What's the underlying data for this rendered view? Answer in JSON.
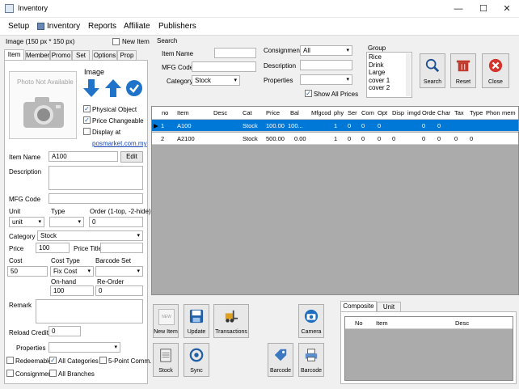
{
  "window": {
    "title": "Inventory",
    "minimize": "—",
    "maximize": "☐",
    "close": "✕"
  },
  "menu": [
    "Setup",
    "Inventory",
    "Reports",
    "Affiliate",
    "Publishers"
  ],
  "left": {
    "image_label": "Image (150 px * 150 px)",
    "new_item_label": "New Item",
    "tabs": [
      "Item",
      "Member",
      "Promo",
      "Set",
      "Options",
      "Prop"
    ],
    "photo_text": "Photo Not Available",
    "image_heading": "Image",
    "physical_object": "Physical Object",
    "price_changeable": "Price Changeable",
    "display_at": "Display at",
    "display_link": "posmarket.com.my",
    "item_name_label": "Item Name",
    "item_name_value": "A100",
    "edit_button": "Edit",
    "description_label": "Description",
    "mfg_code_label": "MFG Code",
    "unit_label": "Unit",
    "type_label": "Type",
    "order_label": "Order (1-top, -2-hide)",
    "unit_value": "unit",
    "order_value": "0",
    "category_label": "Category",
    "category_value": "Stock",
    "price_label": "Price",
    "price_value": "100",
    "price_title_label": "Price Title",
    "cost_label": "Cost",
    "cost_type_label": "Cost Type",
    "barcode_set_label": "Barcode Set",
    "cost_value": "50",
    "cost_type_value": "Fix Cost",
    "on_hand_label": "On-hand",
    "on_hand_value": "100",
    "reorder_label": "Re-Order",
    "reorder_value": "0",
    "remark_label": "Remark",
    "reload_credit_label": "Reload Credit",
    "reload_credit_value": "0",
    "properties_label": "Properties",
    "redeemable": "Redeemable",
    "all_categories": "All Categories",
    "five_point": "5-Point Comm.",
    "consignment": "Consignment",
    "all_branches": "All Branches"
  },
  "search": {
    "heading": "Search",
    "item_name": "Item Name",
    "mfg_code": "MFG Code",
    "category": "Category",
    "category_value": "Stock",
    "consignment": "Consignment",
    "consignment_value": "All",
    "description": "Description",
    "properties": "Properties",
    "show_all_prices": "Show All Prices",
    "group_label": "Group",
    "groups": [
      "Rice",
      "Drink",
      "Large",
      "cover 1",
      "cover 2"
    ],
    "search_btn": "Search",
    "reset_btn": "Reset",
    "close_btn": "Close"
  },
  "grid": {
    "headers": [
      "no",
      "Item",
      "Desc",
      "Cat",
      "Price",
      "Bal",
      "Mfgcod",
      "phy",
      "Ser",
      "Com",
      "Opt",
      "Disp",
      "imgd",
      "Orde",
      "Char",
      "Tax",
      "Type",
      "Phon",
      "mem"
    ],
    "rows": [
      [
        "1",
        "A100",
        "",
        "Stock",
        "100.00",
        "100...",
        "",
        "1",
        "0",
        "0",
        "0",
        "",
        "",
        "0",
        "0",
        "",
        "",
        "",
        ""
      ],
      [
        "2",
        "A2100",
        "",
        "Stock",
        "500.00",
        "0.00",
        "",
        "1",
        "0",
        "0",
        "0",
        "0",
        "",
        "0",
        "0",
        "0",
        "0",
        "",
        ""
      ]
    ]
  },
  "actions": {
    "new_item": "New Item",
    "new_badge": "NEW",
    "update": "Update",
    "transactions": "Transactions",
    "camera": "Camera",
    "stock": "Stock",
    "sync": "Sync",
    "barcode1": "Barcode",
    "barcode2": "Barcode"
  },
  "composite": {
    "tabs": [
      "Composite",
      "Unit"
    ],
    "headers": [
      "No",
      "Item",
      "Desc"
    ]
  }
}
